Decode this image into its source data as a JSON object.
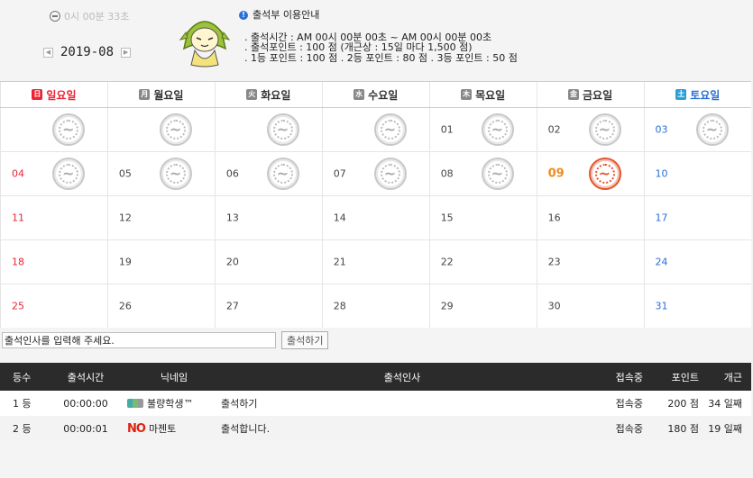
{
  "header": {
    "clock": "0시 00분 33초",
    "month": "2019-08",
    "info_title": "출석부 이용안내",
    "info_lines": [
      ". 출석시간 : AM 00시 00분 00초 ~ AM 00시 00분 00초",
      ". 출석포인트 : 100 점 (개근상 : 15일 마다 1,500 점)",
      ". 1등 포인트 : 100 점   . 2등 포인트 : 80 점   . 3등 포인트 : 50 점"
    ]
  },
  "weekdays": [
    {
      "label": "일요일",
      "box": "日"
    },
    {
      "label": "월요일",
      "box": "月"
    },
    {
      "label": "화요일",
      "box": "火"
    },
    {
      "label": "수요일",
      "box": "水"
    },
    {
      "label": "목요일",
      "box": "木"
    },
    {
      "label": "금요일",
      "box": "金"
    },
    {
      "label": "토요일",
      "box": "土"
    }
  ],
  "weeks": [
    [
      {
        "day": "",
        "stamp": "gray"
      },
      {
        "day": "",
        "stamp": "gray"
      },
      {
        "day": "",
        "stamp": "gray"
      },
      {
        "day": "",
        "stamp": "gray"
      },
      {
        "day": "01",
        "stamp": "gray"
      },
      {
        "day": "02",
        "stamp": "gray"
      },
      {
        "day": "03",
        "stamp": "gray"
      }
    ],
    [
      {
        "day": "04",
        "stamp": "gray"
      },
      {
        "day": "05",
        "stamp": "gray"
      },
      {
        "day": "06",
        "stamp": "gray"
      },
      {
        "day": "07",
        "stamp": "gray"
      },
      {
        "day": "08",
        "stamp": "gray"
      },
      {
        "day": "09",
        "stamp": "red",
        "today": true
      },
      {
        "day": "10"
      }
    ],
    [
      {
        "day": "11"
      },
      {
        "day": "12"
      },
      {
        "day": "13"
      },
      {
        "day": "14"
      },
      {
        "day": "15"
      },
      {
        "day": "16"
      },
      {
        "day": "17"
      }
    ],
    [
      {
        "day": "18"
      },
      {
        "day": "19"
      },
      {
        "day": "20"
      },
      {
        "day": "21"
      },
      {
        "day": "22"
      },
      {
        "day": "23"
      },
      {
        "day": "24"
      }
    ],
    [
      {
        "day": "25"
      },
      {
        "day": "26"
      },
      {
        "day": "27"
      },
      {
        "day": "28"
      },
      {
        "day": "29"
      },
      {
        "day": "30"
      },
      {
        "day": "31"
      }
    ]
  ],
  "greeting": {
    "value": "출석인사를 입력해 주세요.",
    "button": "출석하기"
  },
  "attendance": {
    "headers": {
      "rank": "등수",
      "time": "출석시간",
      "nick": "닉네임",
      "greet": "출석인사",
      "status": "접속중",
      "points": "포인트",
      "streak": "개근"
    },
    "rows": [
      {
        "rank": "1 등",
        "time": "00:00:00",
        "nick_icon": "tri",
        "nick": "불량학생™",
        "greet": "출석하기",
        "status": "접속중",
        "points": "200 점",
        "streak": "34 일째"
      },
      {
        "rank": "2 등",
        "time": "00:00:01",
        "nick_icon": "no",
        "nick_prefix": "NO",
        "nick": "마젠토",
        "greet": "출석합니다.",
        "status": "접속중",
        "points": "180 점",
        "streak": "19 일째"
      }
    ]
  }
}
